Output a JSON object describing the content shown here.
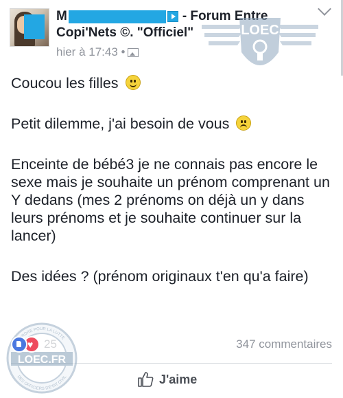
{
  "post": {
    "author_prefix": "M",
    "author_suffix": "- Forum Entre",
    "author_line2": "Copi'Nets ©. \"Officiel\"",
    "timestamp": "hier à 17:43 •",
    "paragraphs": {
      "p1": "Coucou les filles",
      "p2": "Petit dilemme, j'ai besoin de vous",
      "p3": "Enceinte de bébé3 je ne connais pas encore le sexe mais je souhaite un prénom comprenant un Y dedans (mes 2 prénoms on déjà un y dans leurs prénoms et je souhaite continuer sur la lancer)",
      "p4": "Des idées ? (prénom originaux t'en qu'a faire)"
    }
  },
  "reactions": {
    "count": "25",
    "comments": "347 commentaires"
  },
  "actions": {
    "like_label": "J'aime"
  },
  "watermarks": {
    "top_text": "LOEC",
    "bottom_text": "LOEC.FR",
    "bottom_ring_top": "ORDRE POUR LA LUTTE",
    "bottom_ring_bottom": "DES OFFICIERS D'ÉTAT CIVIL"
  },
  "icons": {
    "menu": "chevron-down-icon",
    "audience": "photo-icon",
    "like": "thumbs-up-icon"
  },
  "colors": {
    "redaction": "#23a7e3",
    "meta_gray": "#90949c",
    "like_blue": "#4a78e0",
    "love_red": "#ee4b5e"
  }
}
